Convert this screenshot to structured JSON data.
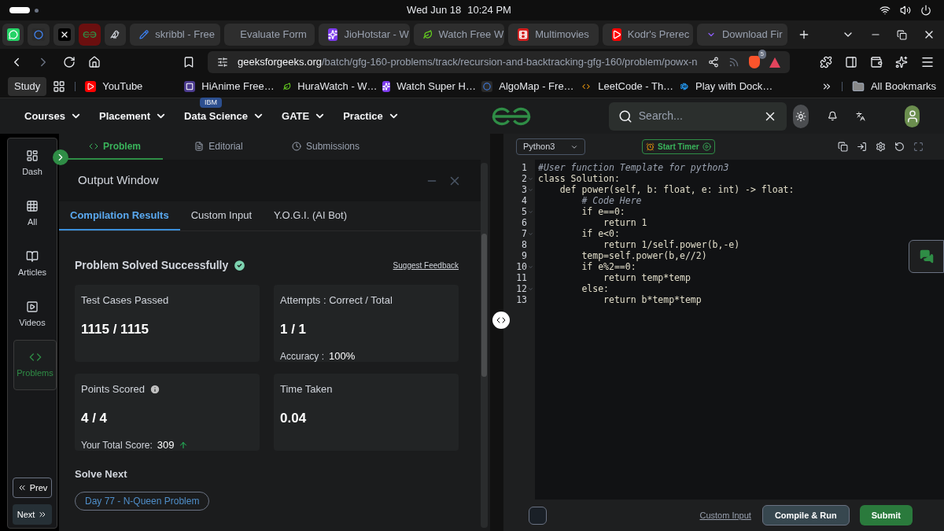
{
  "system_bar": {
    "date": "Wed Jun 18",
    "time": "10:24 PM"
  },
  "pinned_tabs": [
    {
      "kind": "chat",
      "selected": false
    },
    {
      "kind": "ring",
      "selected": false
    },
    {
      "kind": "x",
      "selected": false
    },
    {
      "kind": "gfg",
      "selected": true
    },
    {
      "kind": "bird",
      "selected": false
    }
  ],
  "tabs": [
    {
      "label": "skribbl - Free",
      "kind": "pencil",
      "selected": false
    },
    {
      "label": "Evaluate Form",
      "kind": "gfg",
      "selected": false
    },
    {
      "label": "JioHotstar - W",
      "kind": "star",
      "selected": false
    },
    {
      "label": "Watch Free W",
      "kind": "leaf",
      "selected": false
    },
    {
      "label": "Multimovies",
      "kind": "film",
      "selected": false
    },
    {
      "label": "Kodr's Prerec",
      "kind": "play",
      "selected": false
    },
    {
      "label": "Download Fir",
      "kind": "v",
      "selected": false
    }
  ],
  "address_bar": {
    "host": "geeksforgeeks.org",
    "path": "/batch/gfg-160-problems/track/recursion-and-backtracking-gfg-160/problem/powx-n",
    "shield_count": "5"
  },
  "bookmarks": {
    "folder": "Study",
    "items": [
      {
        "label": "YouTube",
        "kind": "play"
      },
      {
        "label": "HiAnime Free…",
        "kind": "square"
      },
      {
        "label": "HuraWatch - W…",
        "kind": "leaf"
      },
      {
        "label": "Watch Super H…",
        "kind": "star"
      },
      {
        "label": "AlgoMap - Fre…",
        "kind": "ring"
      },
      {
        "label": "LeetCode - Th…",
        "kind": "code"
      },
      {
        "label": "Play with Dock…",
        "kind": "whale"
      }
    ],
    "all": "All Bookmarks"
  },
  "site_nav": {
    "menus": [
      {
        "label": "Courses"
      },
      {
        "label": "Placement"
      },
      {
        "label": "Data Science",
        "badge": "IBM"
      },
      {
        "label": "GATE"
      },
      {
        "label": "Practice"
      }
    ],
    "search": {
      "placeholder": "Search..."
    }
  },
  "sidebar": {
    "items": [
      {
        "label": "Dash",
        "kind": "dash",
        "selected": false
      },
      {
        "label": "All",
        "kind": "all",
        "selected": false
      },
      {
        "label": "Articles",
        "kind": "articles",
        "selected": false
      },
      {
        "label": "Videos",
        "kind": "videos",
        "selected": false
      },
      {
        "label": "Problems",
        "kind": "problems",
        "selected": true
      }
    ],
    "prev": "Prev",
    "next": "Next"
  },
  "problem_tabs": [
    {
      "label": "Problem",
      "kind": "problem",
      "selected": true
    },
    {
      "label": "Editorial",
      "kind": "editorial",
      "selected": false
    },
    {
      "label": "Submissions",
      "kind": "submissions",
      "selected": false
    }
  ],
  "output_window": {
    "title": "Output Window",
    "tabs": [
      {
        "label": "Compilation Results",
        "selected": true
      },
      {
        "label": "Custom Input",
        "selected": false
      },
      {
        "label": "Y.O.G.I. (AI Bot)",
        "selected": false
      }
    ],
    "status": "Problem Solved Successfully",
    "feedback_link": "Suggest Feedback",
    "cards": [
      {
        "title": "Test Cases Passed",
        "value": "1115 / 1115"
      },
      {
        "title": "Attempts : Correct / Total",
        "value": "1 / 1",
        "note_label": "Accuracy :",
        "note_value": "100%"
      },
      {
        "title": "Points Scored",
        "value": "4 / 4",
        "info": true,
        "note_label": "Your Total Score:",
        "note_value": "309",
        "trend_up": true
      },
      {
        "title": "Time Taken",
        "value": "0.04"
      }
    ],
    "solve_next": "Solve Next",
    "next_problem": "Day 77 - N-Queen Problem"
  },
  "editor": {
    "language": "Python3",
    "timer": "Start Timer",
    "lines": [
      {
        "number": "1",
        "text": "#User function Template for python3",
        "kind": "comment",
        "foldable": false
      },
      {
        "number": "2",
        "text": "class Solution:",
        "kind": "code",
        "foldable": true
      },
      {
        "number": "3",
        "text": "    def power(self, b: float, e: int) -> float:",
        "kind": "code",
        "foldable": true
      },
      {
        "number": "4",
        "text": "        # Code Here",
        "kind": "comment",
        "foldable": false
      },
      {
        "number": "5",
        "text": "        if e==0:",
        "kind": "code",
        "foldable": true
      },
      {
        "number": "6",
        "text": "            return 1",
        "kind": "code",
        "foldable": false
      },
      {
        "number": "7",
        "text": "        if e<0:",
        "kind": "code",
        "foldable": true
      },
      {
        "number": "8",
        "text": "            return 1/self.power(b,-e)",
        "kind": "code",
        "foldable": false
      },
      {
        "number": "9",
        "text": "        temp=self.power(b,e//2)",
        "kind": "code",
        "foldable": false
      },
      {
        "number": "10",
        "text": "        if e%2==0:",
        "kind": "code",
        "foldable": true
      },
      {
        "number": "11",
        "text": "            return temp*temp",
        "kind": "code",
        "foldable": false
      },
      {
        "number": "12",
        "text": "        else:",
        "kind": "code",
        "foldable": true
      },
      {
        "number": "13",
        "text": "            return b*temp*temp",
        "kind": "code",
        "foldable": false
      }
    ],
    "custom_input": "Custom Input",
    "compile": "Compile & Run",
    "submit": "Submit"
  }
}
